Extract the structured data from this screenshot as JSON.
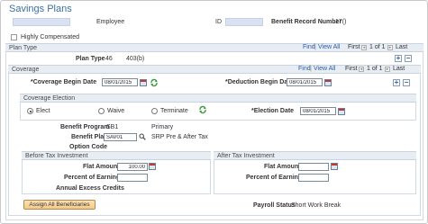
{
  "page": {
    "title": "Savings Plans",
    "employee_label": "Employee",
    "id_label": "ID",
    "benefit_record_label": "Benefit Record Number",
    "benefit_record_value": "17()",
    "highly_comp_label": "Highly Compensated",
    "highly_compensated": false
  },
  "plan_type": {
    "header": "Plan Type",
    "find": "Find",
    "view_all": "View All",
    "first": "First",
    "range": "1 of 1",
    "last": "Last",
    "label": "Plan Type",
    "code": "46",
    "desc": "403(b)"
  },
  "coverage": {
    "header": "Coverage",
    "find": "Find",
    "view_all": "View All",
    "first": "First",
    "range": "1 of 1",
    "last": "Last",
    "begin_label": "*Coverage Begin Date",
    "begin_value": "08/01/2015",
    "deduction_label": "*Deduction Begin Date",
    "deduction_value": "08/01/2015"
  },
  "election": {
    "header": "Coverage Election",
    "elect": "Elect",
    "waive": "Waive",
    "terminate": "Terminate",
    "selected": "Elect",
    "date_label": "*Election Date",
    "date_value": "08/01/2015"
  },
  "benefit": {
    "program_label": "Benefit Program",
    "program_value": "SB1",
    "program_desc": "Primary",
    "plan_label": "Benefit Plan",
    "plan_value": "SAV01",
    "plan_desc": "SRP Pre & After Tax",
    "option_label": "Option Code"
  },
  "before_tax": {
    "header": "Before Tax Investment",
    "flat_label": "Flat Amount",
    "flat_value": "100.00",
    "pct_label": "Percent of Earnings",
    "pct_value": "",
    "excess_label": "Annual Excess Credits"
  },
  "after_tax": {
    "header": "After Tax Investment",
    "flat_label": "Flat Amount",
    "flat_value": "",
    "pct_label": "Percent of Earnings",
    "pct_value": ""
  },
  "footer": {
    "assign_button": "Assign All Beneficiaries",
    "payroll_label": "Payroll Status",
    "payroll_value": "Short Work Break"
  },
  "icons": {
    "add": "plus-icon",
    "remove": "minus-icon",
    "calendar": "calendar-icon",
    "refresh": "refresh-icon",
    "lookup": "magnifier-icon",
    "first": "first-arrow-icon",
    "last": "last-arrow-icon"
  },
  "colors": {
    "title": "#3b6ea5",
    "link": "#2a5da8",
    "shade": "#d9e1f2",
    "button": "#f4c98a"
  }
}
